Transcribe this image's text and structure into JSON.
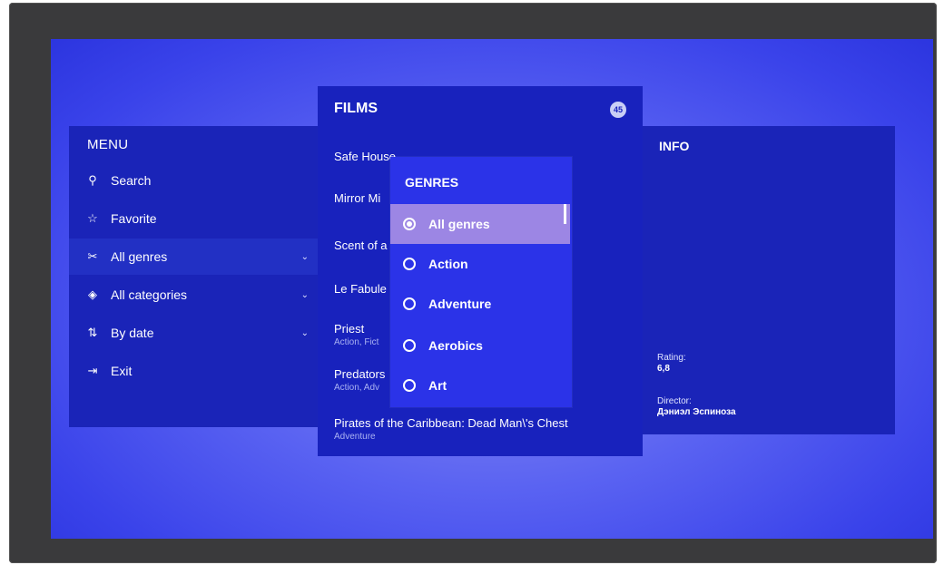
{
  "menu": {
    "title": "MENU",
    "items": [
      {
        "label": "Search",
        "icon": "search-icon",
        "glyph": "⚲"
      },
      {
        "label": "Favorite",
        "icon": "star-icon",
        "glyph": "☆"
      },
      {
        "label": "All genres",
        "icon": "genres-icon",
        "glyph": "✂"
      },
      {
        "label": "All categories",
        "icon": "categories-icon",
        "glyph": "◈"
      },
      {
        "label": "By date",
        "icon": "sort-icon",
        "glyph": "⇅"
      },
      {
        "label": "Exit",
        "icon": "exit-icon",
        "glyph": "⇥"
      }
    ],
    "active_index": 2
  },
  "films": {
    "title": "FILMS",
    "count": "45",
    "items": [
      {
        "title": "Safe House",
        "genres": ""
      },
      {
        "title": "Mirror Mi",
        "genres": ""
      },
      {
        "title": "Scent of a",
        "genres": ""
      },
      {
        "title": "Le Fabule",
        "genres": ""
      },
      {
        "title": "Priest",
        "genres": "Action, Fict"
      },
      {
        "title": "Predators",
        "genres": "Action, Adv"
      },
      {
        "title": "Pirates of the Caribbean: Dead Man\\'s Chest",
        "genres": "Adventure"
      }
    ]
  },
  "genres": {
    "title": "GENRES",
    "options": [
      "All genres",
      "Action",
      "Adventure",
      "Aerobics",
      "Art"
    ],
    "selected": "All genres"
  },
  "info": {
    "title": "INFO",
    "rating_label": "Rating:",
    "rating_value": "6,8",
    "director_label": "Director:",
    "director_value": "Дэниэл Эспиноза"
  },
  "colors": {
    "screen_bg": "#4a54ee",
    "panel_bg": "#1a24b8",
    "popup_bg": "#2b33e8",
    "selected_bg": "#9c86e4"
  }
}
